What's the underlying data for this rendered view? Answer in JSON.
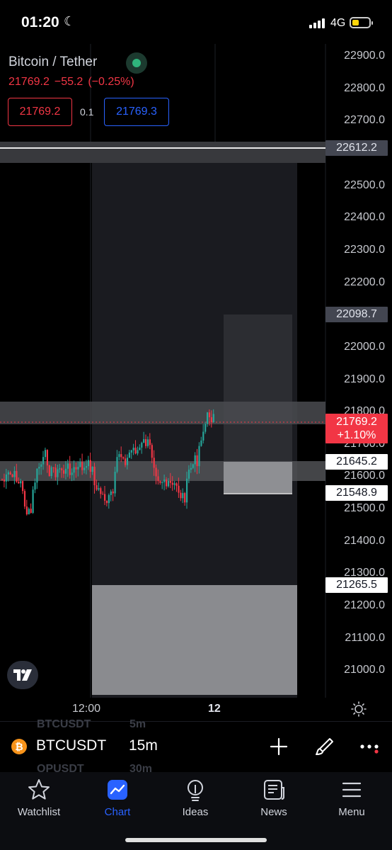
{
  "status_bar": {
    "time": "01:20",
    "network": "4G"
  },
  "symbol": {
    "title": "Bitcoin / Tether",
    "last_price": "21769.2",
    "change": "−55.2",
    "change_pct": "(−0.25%)",
    "sell_price": "21769.2",
    "spread": "0.1",
    "buy_price": "21769.3"
  },
  "price_axis": {
    "labels": [
      "22900.0",
      "22800.0",
      "22700.0",
      "22500.0",
      "22400.0",
      "22300.0",
      "22200.0",
      "22000.0",
      "21900.0",
      "21800.0",
      "21700.0",
      "21600.0",
      "21500.0",
      "21400.0",
      "21300.0",
      "21200.0",
      "21100.0",
      "21000.0"
    ],
    "tags": {
      "upper_level": "22612.2",
      "target": "22098.7",
      "current_price": "21769.2",
      "current_change": "+1.10%",
      "zone_top": "21645.2",
      "zone_bottom": "21548.9",
      "lower_level": "21265.5"
    }
  },
  "time_axis": {
    "label_1": "12:00",
    "label_2": "12"
  },
  "toolbar": {
    "ghost_above_symbol": "BTCUSDT",
    "ghost_above_interval": "5m",
    "ticker": "BTCUSDT",
    "interval": "15m",
    "ghost_below_symbol": "OPUSDT",
    "ghost_below_interval": "30m",
    "coin_glyph": "₿"
  },
  "tabs": [
    {
      "label": "Watchlist",
      "icon": "star-icon"
    },
    {
      "label": "Chart",
      "icon": "chart-icon"
    },
    {
      "label": "Ideas",
      "icon": "lightbulb-icon"
    },
    {
      "label": "News",
      "icon": "newspaper-icon"
    },
    {
      "label": "Menu",
      "icon": "hamburger-icon"
    }
  ],
  "colors": {
    "up": "#26a69a",
    "down": "#f23645",
    "accent": "#2962ff"
  }
}
